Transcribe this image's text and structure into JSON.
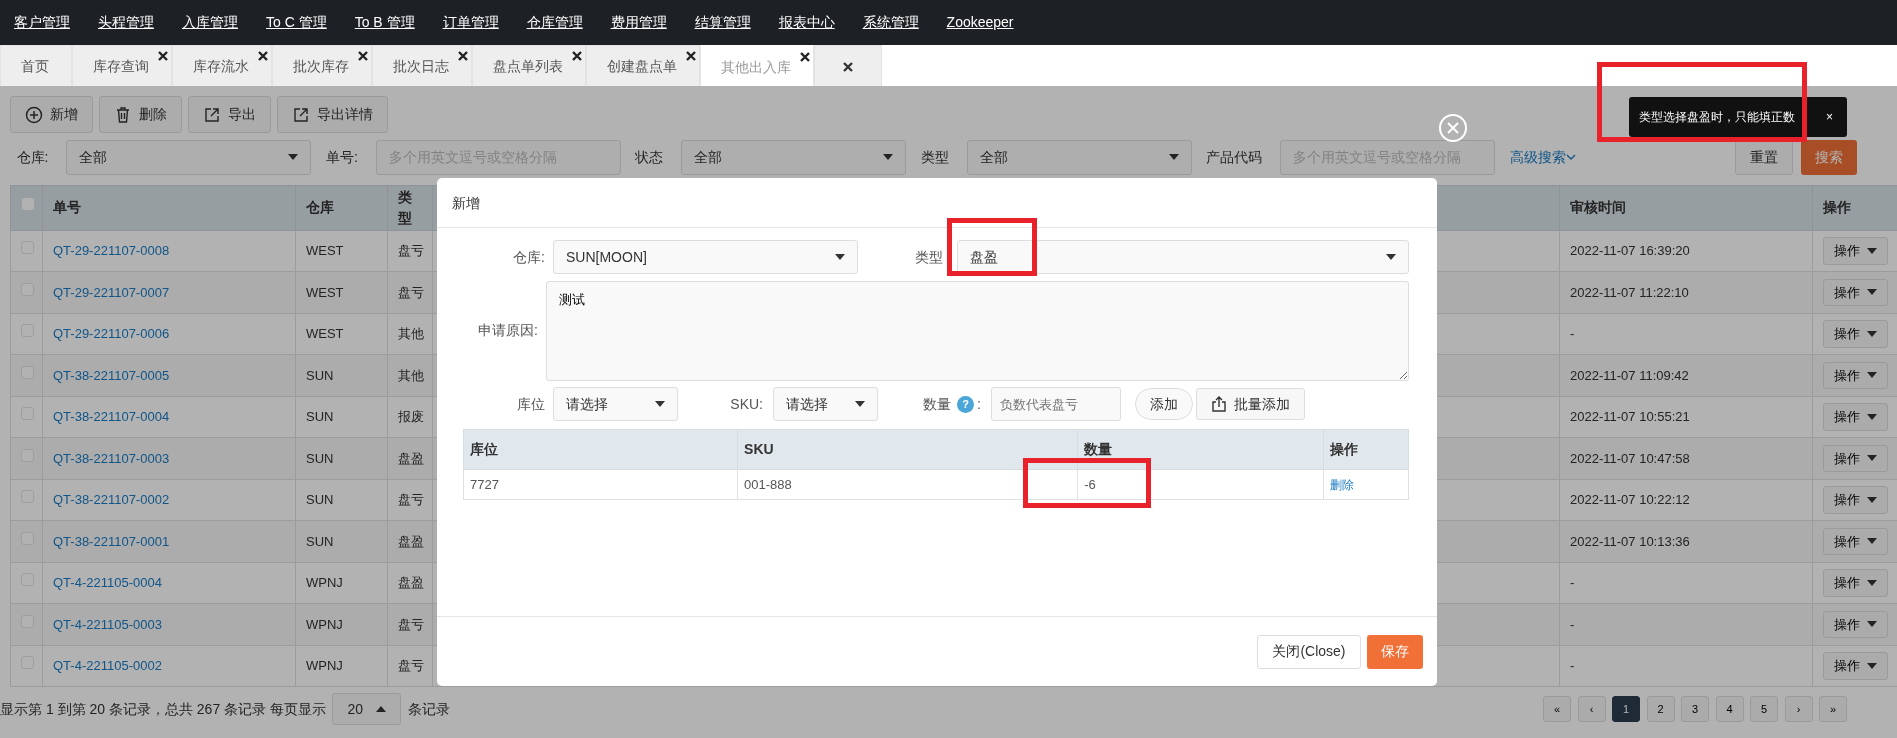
{
  "top_nav": {
    "items": [
      "客户管理",
      "头程管理",
      "入库管理",
      "To C 管理",
      "To B 管理",
      "订单管理",
      "仓库管理",
      "费用管理",
      "结算管理",
      "报表中心",
      "系统管理",
      "Zookeeper"
    ]
  },
  "tabs": [
    {
      "kind": "home",
      "label": "首页",
      "selected": false
    },
    {
      "kind": "page",
      "label": "库存查询",
      "selected": false
    },
    {
      "kind": "page",
      "label": "库存流水",
      "selected": false
    },
    {
      "kind": "page",
      "label": "批次库存",
      "selected": false
    },
    {
      "kind": "page",
      "label": "批次日志",
      "selected": false
    },
    {
      "kind": "page",
      "label": "盘点单列表",
      "selected": false
    },
    {
      "kind": "page",
      "label": "创建盘点单",
      "selected": false
    },
    {
      "kind": "page",
      "label": "其他出入库",
      "selected": true
    },
    {
      "kind": "close_all",
      "selected": false
    }
  ],
  "toolbar": [
    {
      "label": "新增"
    },
    {
      "label": "删除"
    },
    {
      "label": "导出"
    },
    {
      "label": "导出详情"
    }
  ],
  "filters": [
    {
      "kind": "select",
      "label": "仓库:",
      "value": "全部"
    },
    {
      "kind": "input",
      "label": "单号:",
      "placeholder": "多个用英文逗号或空格分隔"
    },
    {
      "kind": "select",
      "label": "状态",
      "value": "全部"
    },
    {
      "kind": "select",
      "label": "类型",
      "value": "全部"
    },
    {
      "kind": "input",
      "label": "产品代码",
      "placeholder": "多个用英文逗号或空格分隔"
    }
  ],
  "advanced_search": "高级搜索",
  "reset_button": "重置",
  "search_button": "搜索",
  "table": {
    "header_checked": false,
    "columns": [
      "单号",
      "仓库",
      "类型",
      "审核时间",
      "操作"
    ],
    "rows": [
      {
        "checked": false,
        "number": "QT-29-221107-0008",
        "warehouse": "WEST",
        "type": "盘亏",
        "audit_time": "2022-11-07 16:39:20",
        "action": "操作"
      },
      {
        "checked": false,
        "number": "QT-29-221107-0007",
        "warehouse": "WEST",
        "type": "盘亏",
        "audit_time": "2022-11-07 11:22:10",
        "action": "操作"
      },
      {
        "checked": false,
        "number": "QT-29-221107-0006",
        "warehouse": "WEST",
        "type": "其他",
        "audit_time": "-",
        "action": "操作"
      },
      {
        "checked": false,
        "number": "QT-38-221107-0005",
        "warehouse": "SUN",
        "type": "其他",
        "audit_time": "2022-11-07 11:09:42",
        "action": "操作"
      },
      {
        "checked": false,
        "number": "QT-38-221107-0004",
        "warehouse": "SUN",
        "type": "报废",
        "audit_time": "2022-11-07 10:55:21",
        "action": "操作"
      },
      {
        "checked": false,
        "number": "QT-38-221107-0003",
        "warehouse": "SUN",
        "type": "盘盈",
        "audit_time": "2022-11-07 10:47:58",
        "action": "操作"
      },
      {
        "checked": false,
        "number": "QT-38-221107-0002",
        "warehouse": "SUN",
        "type": "盘亏",
        "audit_time": "2022-11-07 10:22:12",
        "action": "操作"
      },
      {
        "checked": false,
        "number": "QT-38-221107-0001",
        "warehouse": "SUN",
        "type": "盘盈",
        "audit_time": "2022-11-07 10:13:36",
        "action": "操作"
      },
      {
        "checked": false,
        "number": "QT-4-221105-0004",
        "warehouse": "WPNJ",
        "type": "盘盈",
        "audit_time": "-",
        "action": "操作"
      },
      {
        "checked": false,
        "number": "QT-4-221105-0003",
        "warehouse": "WPNJ",
        "type": "盘亏",
        "audit_time": "-",
        "action": "操作"
      },
      {
        "checked": false,
        "number": "QT-4-221105-0002",
        "warehouse": "WPNJ",
        "type": "盘亏",
        "audit_time": "-",
        "action": "操作"
      }
    ]
  },
  "footer": {
    "summary": "显示第 1 到第 20 条记录，总共 267 条记录 每页显示",
    "page_size": "20",
    "suffix": "条记录",
    "pages": [
      {
        "label": "«",
        "selected": false
      },
      {
        "label": "‹",
        "selected": false
      },
      {
        "label": "1",
        "selected": true
      },
      {
        "label": "2",
        "selected": false
      },
      {
        "label": "3",
        "selected": false
      },
      {
        "label": "4",
        "selected": false
      },
      {
        "label": "5",
        "selected": false
      },
      {
        "label": "›",
        "selected": false
      },
      {
        "label": "»",
        "selected": false
      }
    ]
  },
  "modal": {
    "title": "新增",
    "warehouse": {
      "label": "仓库:",
      "value": "SUN[MOON]"
    },
    "type": {
      "label": "类型",
      "value": "盘盈"
    },
    "reason": {
      "label": "申请原因:",
      "value": "测试"
    },
    "location": {
      "label": "库位",
      "value": "请选择"
    },
    "sku": {
      "label": "SKU:",
      "value": "请选择"
    },
    "quantity": {
      "label": "数量",
      "help": "?",
      "colon": ":",
      "placeholder": "负数代表盘亏"
    },
    "add_button": "添加",
    "batch_add_button": "批量添加",
    "items": {
      "columns": [
        "库位",
        "SKU",
        "数量",
        "操作"
      ],
      "rows": [
        {
          "location": "7727",
          "sku": "001-888",
          "quantity": "-6",
          "action": "删除"
        }
      ]
    },
    "close_button": "关闭(Close)",
    "save_button": "保存"
  },
  "toast": {
    "message": "类型选择盘盈时，只能填正数",
    "close": "×"
  }
}
